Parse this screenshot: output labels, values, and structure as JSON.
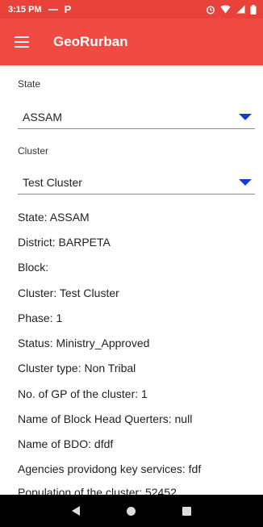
{
  "status_bar": {
    "time": "3:15 PM",
    "app_letter": "P"
  },
  "app_bar": {
    "title": "GeoRurban"
  },
  "form": {
    "state_label": "State",
    "state_value": "ASSAM",
    "cluster_label": "Cluster",
    "cluster_value": "Test Cluster"
  },
  "info": [
    "State: ASSAM",
    "District: BARPETA",
    "Block:",
    "Cluster: Test Cluster",
    "Phase: 1",
    "Status: Ministry_Approved",
    "Cluster type: Non Tribal",
    "No. of GP of the cluster: 1",
    " Name of Block Head Querters: null",
    "Name of BDO: dfdf",
    "Agencies providong key services: fdf",
    "Population of the cluster: 52452"
  ],
  "colors": {
    "status_bar": "#e8423b",
    "app_bar": "#f04a43",
    "spinner_arrow": "#1a3ad6"
  },
  "icons": [
    "alarm-icon",
    "wifi-icon",
    "signal-icon",
    "battery-icon",
    "menu-icon",
    "dropdown-arrow-icon",
    "back-icon",
    "home-icon",
    "recents-icon"
  ]
}
